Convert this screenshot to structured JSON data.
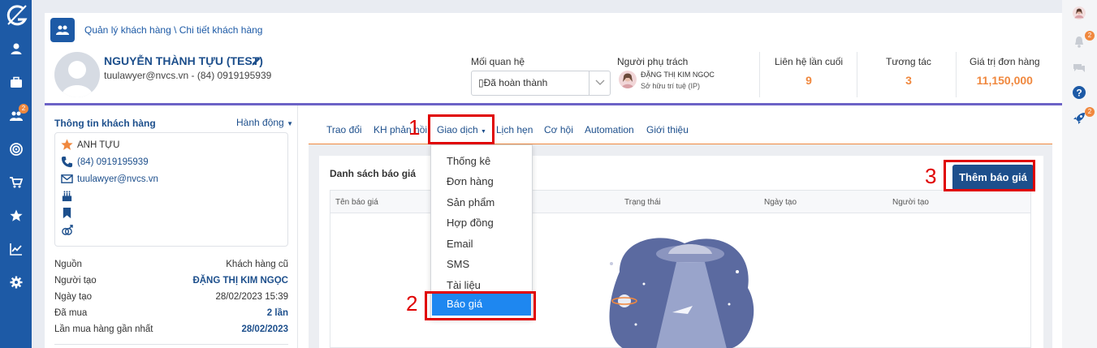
{
  "breadcrumb": "Quản lý khách hàng \\ Chi tiết khách hàng",
  "customer": {
    "name": "NGUYỄN THÀNH TỰU (TEST)",
    "contact": "tuulawyer@nvcs.vn - (84) 0919195939"
  },
  "relationship": {
    "label": "Mối quan hệ",
    "value": "▯Đã hoàn thành"
  },
  "owner": {
    "label": "Người phụ trách",
    "name": "ĐẶNG THỊ KIM NGỌC",
    "dept": "Sở hữu trí tuệ (IP)"
  },
  "stats": [
    {
      "label": "Liên hệ lần cuối",
      "value": "9"
    },
    {
      "label": "Tương tác",
      "value": "3"
    },
    {
      "label": "Giá trị đơn hàng",
      "value": "11,150,000"
    }
  ],
  "left_panel": {
    "title": "Thông tin khách hàng",
    "action": "Hành động",
    "display_name": "ANH TỰU",
    "phone": "(84) 0919195939",
    "email": "tuulawyer@nvcs.vn",
    "info": [
      {
        "label": "Nguồn",
        "value": "Khách hàng cũ"
      },
      {
        "label": "Người tạo",
        "value": "ĐẶNG THỊ KIM NGỌC"
      },
      {
        "label": "Ngày tạo",
        "value": "28/02/2023 15:39"
      },
      {
        "label": "Đã mua",
        "value": "2 lần"
      },
      {
        "label": "Lần mua hàng gần nhất",
        "value": "28/02/2023"
      }
    ]
  },
  "tabs": [
    "Trao đổi",
    "KH phản hồi",
    "Giao dịch",
    "Lịch hẹn",
    "Cơ hội",
    "Automation",
    "Giới thiệu"
  ],
  "dropdown": [
    "Thống kê",
    "Đơn hàng",
    "Sản phẩm",
    "Hợp đồng",
    "Email",
    "SMS",
    "Tài liệu",
    "Báo giá"
  ],
  "quote_list": {
    "title": "Danh sách báo giá",
    "add_button": "Thêm báo giá",
    "columns": [
      "Tên báo giá",
      "Trạng thái",
      "Ngày tạo",
      "Người tạo"
    ]
  },
  "sidebar_badges": {
    "users": "2"
  },
  "right_badges": {
    "bell": "2",
    "rocket": "2"
  },
  "annotations": [
    "1",
    "2",
    "3"
  ],
  "colors": {
    "primary": "#1d5aa6",
    "accent": "#f0883e",
    "highlight": "#e00000",
    "active_item": "#1e87f0"
  }
}
